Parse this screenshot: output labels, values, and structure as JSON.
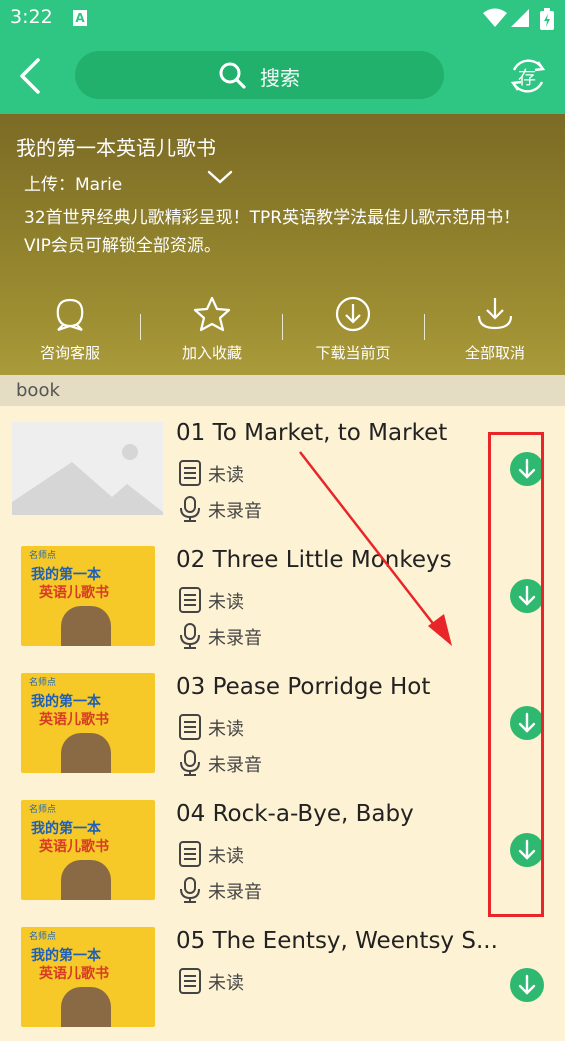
{
  "status_bar": {
    "time": "3:22",
    "indicator": "A",
    "icons": [
      "wifi-icon",
      "cell-signal-icon",
      "battery-icon"
    ]
  },
  "app_bar": {
    "search_placeholder": "搜索",
    "store_label": "存"
  },
  "book": {
    "title": "我的第一本英语儿歌书",
    "uploader": "上传：Marie",
    "description": "32首世界经典儿歌精彩呈现！TPR英语教学法最佳儿歌示范用书！VIP会员可解锁全部资源。"
  },
  "actions": [
    {
      "label": "咨询客服",
      "icon": "customer-service-icon"
    },
    {
      "label": "加入收藏",
      "icon": "star-icon"
    },
    {
      "label": "下载当前页",
      "icon": "download-circle-icon"
    },
    {
      "label": "全部取消",
      "icon": "download-arrow-icon"
    }
  ],
  "section_label": "book",
  "cover": {
    "tag": "名师点",
    "title_line1": "我的第一本",
    "title_line2": "英语儿歌书"
  },
  "items": [
    {
      "title": "01 To Market, to Market",
      "read_status": "未读",
      "record_status": "未录音",
      "thumb": "placeholder"
    },
    {
      "title": "02 Three Little Monkeys",
      "read_status": "未读",
      "record_status": "未录音",
      "thumb": "cover"
    },
    {
      "title": "03 Pease Porridge Hot",
      "read_status": "未读",
      "record_status": "未录音",
      "thumb": "cover"
    },
    {
      "title": "04 Rock-a-Bye, Baby",
      "read_status": "未读",
      "record_status": "未录音",
      "thumb": "cover"
    },
    {
      "title": "05 The Eentsy, Weentsy S...",
      "read_status": "未读",
      "record_status": "未录音",
      "thumb": "cover"
    }
  ],
  "colors": {
    "primary": "#2fc582",
    "download": "#2fb86f",
    "annotation": "#e8262a",
    "list_bg": "#fdf2d4"
  }
}
